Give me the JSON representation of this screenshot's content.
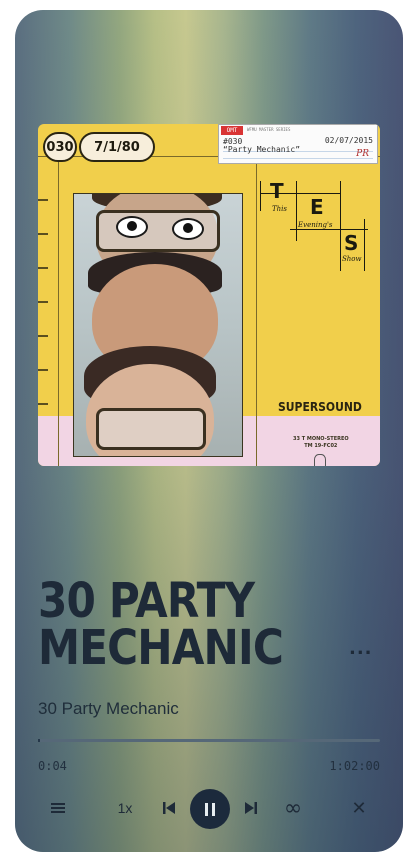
{
  "album_art": {
    "episode_number": "030",
    "date": "7/1/80",
    "label_card": {
      "brand": "OMT",
      "brand_sub": "WFMU MASTER SERIES",
      "number": "#030",
      "date": "02/07/2015",
      "title": "“Party Mechanic”",
      "signature": "PR"
    },
    "show_words": {
      "t": "T",
      "e": "E",
      "s": "S",
      "this": "This",
      "evenings": "Evening's",
      "show": "Show"
    },
    "brand": "SUPERSOUND",
    "stereo_line1": "33 T MONO-STEREO",
    "stereo_line2": "TM 19-FC02"
  },
  "track": {
    "title": "30 PARTY MECHANIC",
    "subtitle": "30 Party Mechanic",
    "more_label": "...",
    "progress_fraction": 0.006
  },
  "time": {
    "elapsed": "0:04",
    "total": "1:02:00"
  },
  "controls": {
    "speed": "1x",
    "loop_glyph": "∞",
    "close_glyph": "✕"
  }
}
